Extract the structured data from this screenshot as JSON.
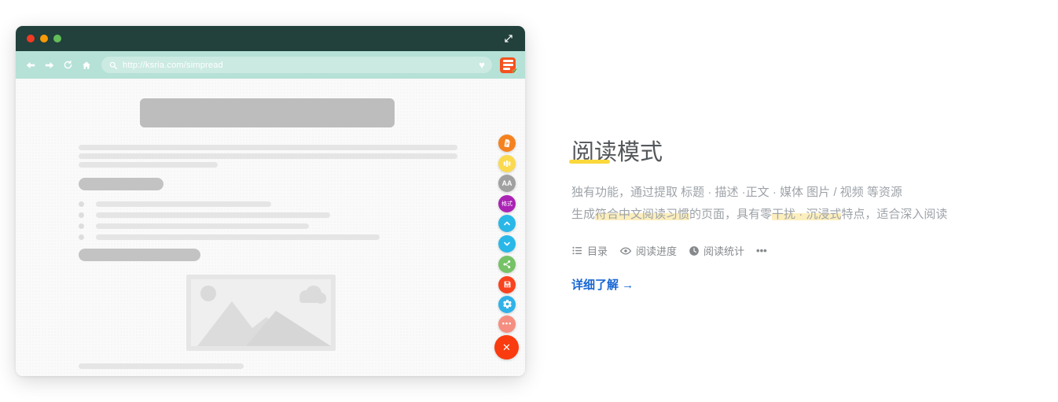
{
  "browser_mockup": {
    "url": "http://ksria.com/simpread",
    "titlebar_color": "#22403c",
    "toolbar_color": "#b5e1d6",
    "content_bg": "#fafafa",
    "traffic_lights": [
      "#f23a24",
      "#f79a05",
      "#63bd58"
    ],
    "logo_color": "#f4511e",
    "logo_check": "✔"
  },
  "float_buttons": [
    {
      "name": "reading",
      "color": "#f5821f",
      "icon": "page"
    },
    {
      "name": "layout",
      "color": "#fbd94e",
      "icon": "columns"
    },
    {
      "name": "font-size",
      "color": "#a0a0a0",
      "label": "AA"
    },
    {
      "name": "format",
      "color": "#ab22b5",
      "label": "格式"
    },
    {
      "name": "scroll-up",
      "color": "#29b7e8",
      "icon": "chevron-up"
    },
    {
      "name": "scroll-down",
      "color": "#29b7e8",
      "icon": "chevron-down"
    },
    {
      "name": "share",
      "color": "#76c267",
      "icon": "share"
    },
    {
      "name": "save",
      "color": "#f9421e",
      "icon": "save"
    },
    {
      "name": "settings",
      "color": "#30b2e8",
      "icon": "gear"
    },
    {
      "name": "more",
      "color": "#f58e80",
      "label": "•••"
    },
    {
      "name": "close",
      "color": "#f93b0f",
      "label": "✕",
      "large": true
    }
  ],
  "feature_panel": {
    "title": "阅读模式",
    "accent_yellow": "#fbd83b",
    "highlight_bg": "#f7d96870",
    "description_line1": "独有功能，通过提取 标题 · 描述 ·正文 · 媒体 图片 / 视频 等资源",
    "description_line2": [
      {
        "text": "生成",
        "hl": false
      },
      {
        "text": "符合中文阅读习惯",
        "hl": true
      },
      {
        "text": "的页面，具有零",
        "hl": false
      },
      {
        "text": "干扰 · 沉浸式",
        "hl": true
      },
      {
        "text": "特点，适合深入阅读",
        "hl": false
      }
    ],
    "subfeatures": [
      {
        "icon": "list-icon",
        "label": "目录"
      },
      {
        "icon": "eye-icon",
        "label": "阅读进度"
      },
      {
        "icon": "clock-icon",
        "label": "阅读统计"
      },
      {
        "icon": "more-dots-icon",
        "label": "•••"
      }
    ],
    "link_label": "详细了解 →",
    "link_color": "#1967d2"
  }
}
